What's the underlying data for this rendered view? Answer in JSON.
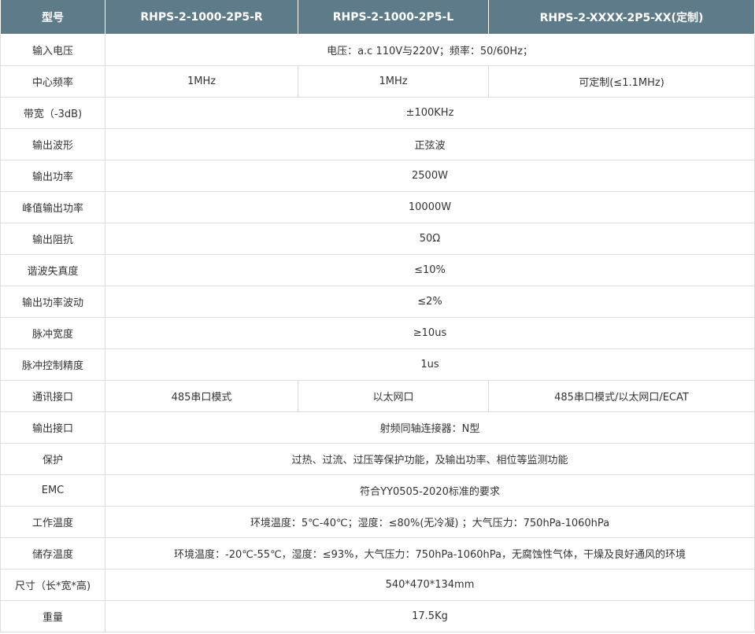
{
  "table": {
    "headers": [
      "型号",
      "RHPS-2-1000-2P5-R",
      "RHPS-2-1000-2P5-L",
      "RHPS-2-XXXX-2P5-XX(定制)"
    ],
    "rows": [
      {
        "label": "输入电压",
        "cells": [
          "电压：a.c 110V与220V；频率：50/60Hz；"
        ]
      },
      {
        "label": "中心频率",
        "cells": [
          "1MHz",
          "1MHz",
          "可定制(≤1.1MHz)"
        ]
      },
      {
        "label": "带宽（-3dB)",
        "cells": [
          "±100KHz"
        ]
      },
      {
        "label": "输出波形",
        "cells": [
          "正弦波"
        ]
      },
      {
        "label": "输出功率",
        "cells": [
          "2500W"
        ]
      },
      {
        "label": "峰值输出功率",
        "cells": [
          "10000W"
        ]
      },
      {
        "label": "输出阻抗",
        "cells": [
          "50Ω"
        ]
      },
      {
        "label": "谐波失真度",
        "cells": [
          "≤10%"
        ]
      },
      {
        "label": "输出功率波动",
        "cells": [
          "≤2%"
        ]
      },
      {
        "label": "脉冲宽度",
        "cells": [
          "≥10us"
        ]
      },
      {
        "label": "脉冲控制精度",
        "cells": [
          "1us"
        ]
      },
      {
        "label": "通讯接口",
        "cells": [
          "485串口模式",
          "以太网口",
          "485串口模式/以太网口/ECAT"
        ]
      },
      {
        "label": "输出接口",
        "cells": [
          "射频同轴连接器：N型"
        ]
      },
      {
        "label": "保护",
        "cells": [
          "过热、过流、过压等保护功能，及输出功率、相位等监测功能"
        ]
      },
      {
        "label": "EMC",
        "cells": [
          "符合YY0505-2020标准的要求"
        ]
      },
      {
        "label": "工作温度",
        "cells": [
          "环境温度：5℃-40℃；湿度：≤80%(无冷凝) ；大气压力：750hPa-1060hPa"
        ]
      },
      {
        "label": "储存温度",
        "cells": [
          "环境温度：-20℃-55℃，湿度：≤93%，大气压力：750hPa-1060hPa，无腐蚀性气体，干燥及良好通风的环境"
        ]
      },
      {
        "label": "尺寸（长*宽*高)",
        "cells": [
          "540*470*134mm"
        ]
      },
      {
        "label": "重量",
        "cells": [
          "17.5Kg"
        ]
      }
    ]
  }
}
